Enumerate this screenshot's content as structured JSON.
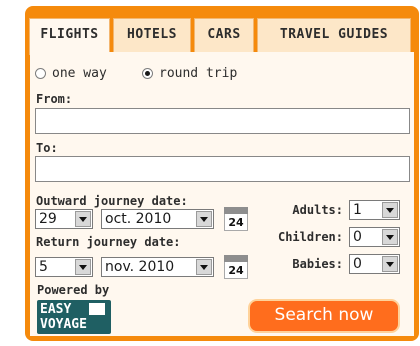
{
  "tabs": {
    "flights": "FLIGHTS",
    "hotels": "HOTELS",
    "cars": "CARS",
    "travel_guides": "TRAVEL GUIDES"
  },
  "trip": {
    "one_way": "one way",
    "round_trip": "round trip",
    "selected": "round trip"
  },
  "from": {
    "label": "From:",
    "value": ""
  },
  "to": {
    "label": "To:",
    "value": ""
  },
  "outward": {
    "label": "Outward journey date:",
    "day": "29",
    "month": "oct. 2010",
    "calendar_day": "24"
  },
  "return": {
    "label": "Return journey date:",
    "day": "5",
    "month": "nov. 2010",
    "calendar_day": "24"
  },
  "passengers": {
    "adults_label": "Adults:",
    "adults": "1",
    "children_label": "Children:",
    "children": "0",
    "babies_label": "Babies:",
    "babies": "0"
  },
  "powered_by": "Powered by",
  "logo": {
    "line1": "EASY",
    "line2": "VOYAGE"
  },
  "search_button": "Search now",
  "colors": {
    "frame": "#f58a0c",
    "panel": "#fff8ef",
    "button": "#ff6d1d",
    "logo": "#1f5f63"
  },
  "icons": {
    "calendar": "calendar-icon",
    "dropdown": "chevron-down-icon",
    "logo_flag": "flag-icon"
  }
}
